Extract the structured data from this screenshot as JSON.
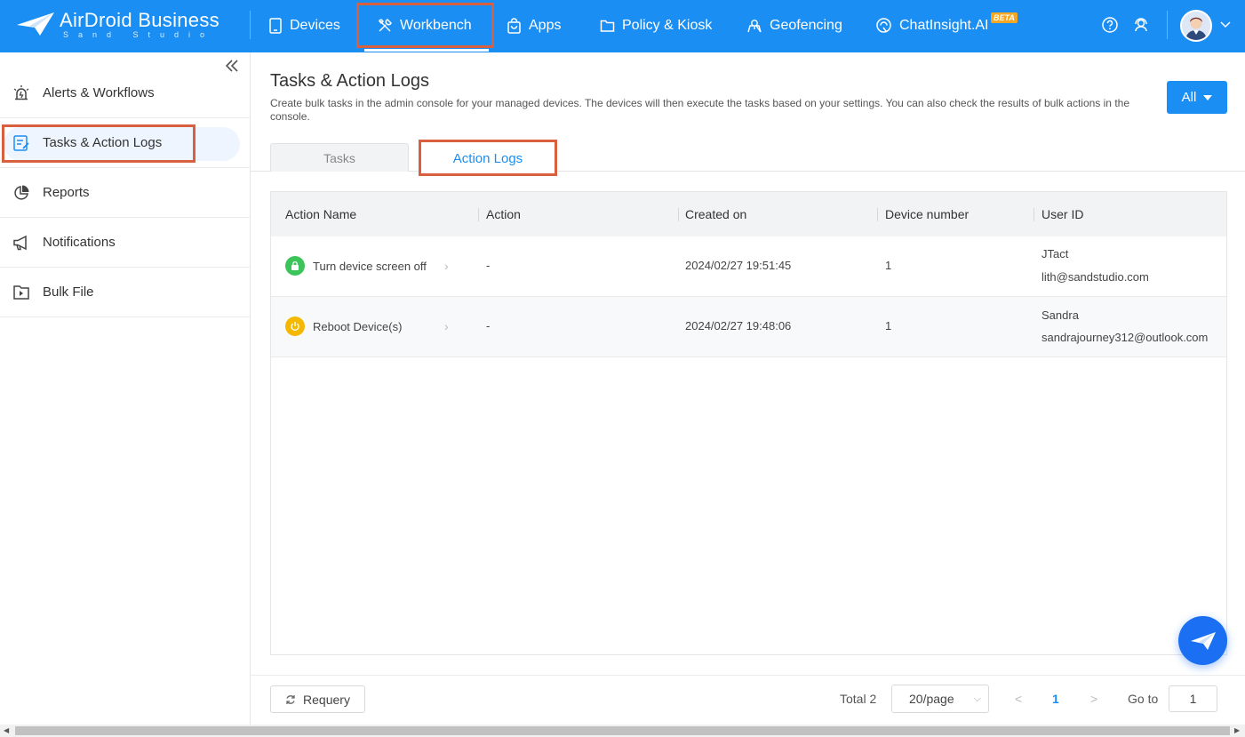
{
  "app": {
    "logo_name": "AirDroid Business",
    "logo_sub": "Sand Studio"
  },
  "topnav": {
    "items": [
      {
        "label": "Devices",
        "icon": "tablet-icon"
      },
      {
        "label": "Workbench",
        "icon": "tools-icon",
        "active": true
      },
      {
        "label": "Apps",
        "icon": "shopping-bag-icon"
      },
      {
        "label": "Policy & Kiosk",
        "icon": "folder-icon"
      },
      {
        "label": "Geofencing",
        "icon": "map-pin-icon"
      },
      {
        "label": "ChatInsight.AI",
        "icon": "chat-ai-icon",
        "badge": "BETA"
      }
    ],
    "right_icons": [
      "help-icon",
      "support-agent-icon"
    ],
    "accent_color": "#1a8ef2"
  },
  "sidebar": {
    "items": [
      {
        "label": "Alerts & Workflows",
        "icon": "alarm-icon"
      },
      {
        "label": "Tasks & Action Logs",
        "icon": "task-list-icon",
        "active": true
      },
      {
        "label": "Reports",
        "icon": "pie-chart-icon"
      },
      {
        "label": "Notifications",
        "icon": "megaphone-icon"
      },
      {
        "label": "Bulk File",
        "icon": "file-folder-icon"
      }
    ]
  },
  "main": {
    "title": "Tasks & Action Logs",
    "description": "Create bulk tasks in the admin console for your managed devices. The devices will then execute the tasks based on your settings. You can also check the results of bulk actions in the console.",
    "filter_label": "All",
    "tabs": [
      {
        "label": "Tasks"
      },
      {
        "label": "Action Logs",
        "active": true
      }
    ]
  },
  "table": {
    "columns": [
      "Action Name",
      "Action",
      "Created on",
      "Device number",
      "User ID"
    ],
    "rows": [
      {
        "action_name": "Turn device screen off",
        "status_color": "#3cc35a",
        "status_icon": "lock-icon",
        "action": "-",
        "created_on": "2024/02/27 19:51:45",
        "device_number": "1",
        "user_name": "JTact",
        "user_email": "lith@sandstudio.com"
      },
      {
        "action_name": "Reboot Device(s)",
        "status_color": "#f5b800",
        "status_icon": "power-icon",
        "action": "-",
        "created_on": "2024/02/27 19:48:06",
        "device_number": "1",
        "user_name": "Sandra",
        "user_email": "sandrajourney312@outlook.com"
      }
    ]
  },
  "footer": {
    "requery_label": "Requery",
    "total_label": "Total 2",
    "per_page": "20/page",
    "prev": "<",
    "current_page": "1",
    "next": ">",
    "goto_label": "Go to",
    "goto_value": "1"
  }
}
